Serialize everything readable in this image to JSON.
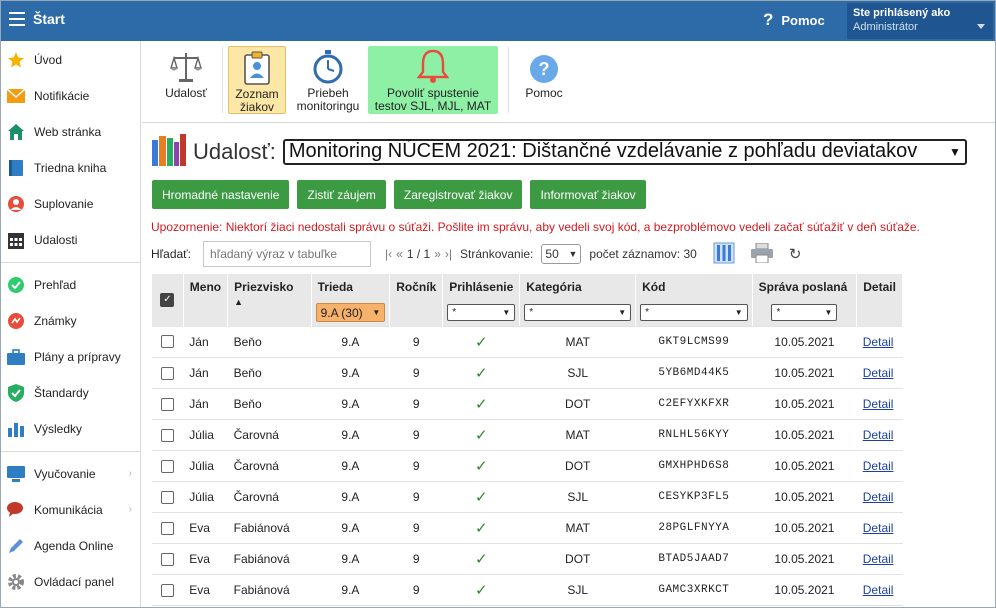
{
  "topbar": {
    "title": "Štart",
    "help_label": "Pomoc",
    "user_label": "Ste prihlásený ako",
    "user_role": "Administrátor"
  },
  "sidebar": {
    "items": [
      {
        "label": "Úvod",
        "icon": "star-icon"
      },
      {
        "label": "Notifikácie",
        "icon": "envelope-icon"
      },
      {
        "label": "Web stránka",
        "icon": "home-icon"
      },
      {
        "label": "Triedna kniha",
        "icon": "book-icon"
      },
      {
        "label": "Suplovanie",
        "icon": "user-swap-icon"
      },
      {
        "label": "Udalosti",
        "icon": "calendar-icon"
      },
      {
        "label": "Prehľad",
        "icon": "check-circle-icon"
      },
      {
        "label": "Známky",
        "icon": "grades-icon"
      },
      {
        "label": "Plány a prípravy",
        "icon": "briefcase-icon"
      },
      {
        "label": "Štandardy",
        "icon": "shield-check-icon"
      },
      {
        "label": "Výsledky",
        "icon": "bar-chart-icon"
      },
      {
        "label": "Vyučovanie",
        "icon": "teaching-icon"
      },
      {
        "label": "Komunikácia",
        "icon": "chat-icon"
      },
      {
        "label": "Agenda Online",
        "icon": "pen-icon"
      },
      {
        "label": "Ovládací panel",
        "icon": "gear-icon"
      }
    ]
  },
  "toolbar": {
    "events": "Udalosť",
    "students_list_1": "Zoznam",
    "students_list_2": "žiakov",
    "progress_1": "Priebeh",
    "progress_2": "monitoringu",
    "allow_1": "Povoliť spustenie",
    "allow_2": "testov SJL, MJL, MAT",
    "help": "Pomoc"
  },
  "event": {
    "label": "Udalosť:",
    "selected": "Monitoring NÚCEM 2021: Dištančné vzdelávanie z pohľadu deviatakov"
  },
  "actions": {
    "bulk": "Hromadné nastavenie",
    "interest": "Zistiť záujem",
    "register": "Zaregistrovať žiakov",
    "inform": "Informovať žiakov"
  },
  "warning": "Upozornenie: Niektorí žiaci nedostali správu o súťaži. Pošlite im správu, aby vedeli svoj kód, a bezproblémovo vedeli začať súťažiť v deň súťaže.",
  "search": {
    "label": "Hľadať:",
    "placeholder": "hľadaný výraz v tabuľke"
  },
  "pager": {
    "first": "|‹",
    "prev": "«",
    "info": "1 / 1",
    "next": "»",
    "last": "›|",
    "paging_label": "Stránkovanie:",
    "page_size": "50",
    "count_label": "počet záznamov: 30"
  },
  "table": {
    "headers": {
      "name": "Meno",
      "surname": "Priezvisko",
      "class": "Trieda",
      "year": "Ročník",
      "login": "Prihlásenie",
      "category": "Kategória",
      "code": "Kód",
      "sent": "Správa poslaná",
      "detail": "Detail"
    },
    "filters": {
      "class": "9.A (30)",
      "login": "*",
      "category": "*",
      "code": "*",
      "sent": "*"
    },
    "rows": [
      {
        "name": "Ján",
        "surname": "Beňo",
        "class": "9.A",
        "year": "9",
        "login": "✓",
        "category": "MAT",
        "code": "GKT9LCMS99",
        "sent": "10.05.2021",
        "detail": "Detail"
      },
      {
        "name": "Ján",
        "surname": "Beňo",
        "class": "9.A",
        "year": "9",
        "login": "✓",
        "category": "SJL",
        "code": "5YB6MD44K5",
        "sent": "10.05.2021",
        "detail": "Detail"
      },
      {
        "name": "Ján",
        "surname": "Beňo",
        "class": "9.A",
        "year": "9",
        "login": "✓",
        "category": "DOT",
        "code": "C2EFYXKFXR",
        "sent": "10.05.2021",
        "detail": "Detail"
      },
      {
        "name": "Júlia",
        "surname": "Čarovná",
        "class": "9.A",
        "year": "9",
        "login": "✓",
        "category": "MAT",
        "code": "RNLHL56KYY",
        "sent": "10.05.2021",
        "detail": "Detail"
      },
      {
        "name": "Júlia",
        "surname": "Čarovná",
        "class": "9.A",
        "year": "9",
        "login": "✓",
        "category": "DOT",
        "code": "GMXHPHD6S8",
        "sent": "10.05.2021",
        "detail": "Detail"
      },
      {
        "name": "Júlia",
        "surname": "Čarovná",
        "class": "9.A",
        "year": "9",
        "login": "✓",
        "category": "SJL",
        "code": "CESYKP3FL5",
        "sent": "10.05.2021",
        "detail": "Detail"
      },
      {
        "name": "Eva",
        "surname": "Fabiánová",
        "class": "9.A",
        "year": "9",
        "login": "✓",
        "category": "MAT",
        "code": "28PGLFNYYA",
        "sent": "10.05.2021",
        "detail": "Detail"
      },
      {
        "name": "Eva",
        "surname": "Fabiánová",
        "class": "9.A",
        "year": "9",
        "login": "✓",
        "category": "DOT",
        "code": "BTAD5JAAD7",
        "sent": "10.05.2021",
        "detail": "Detail"
      },
      {
        "name": "Eva",
        "surname": "Fabiánová",
        "class": "9.A",
        "year": "9",
        "login": "✓",
        "category": "SJL",
        "code": "GAMC3XRKCT",
        "sent": "10.05.2021",
        "detail": "Detail"
      }
    ]
  }
}
